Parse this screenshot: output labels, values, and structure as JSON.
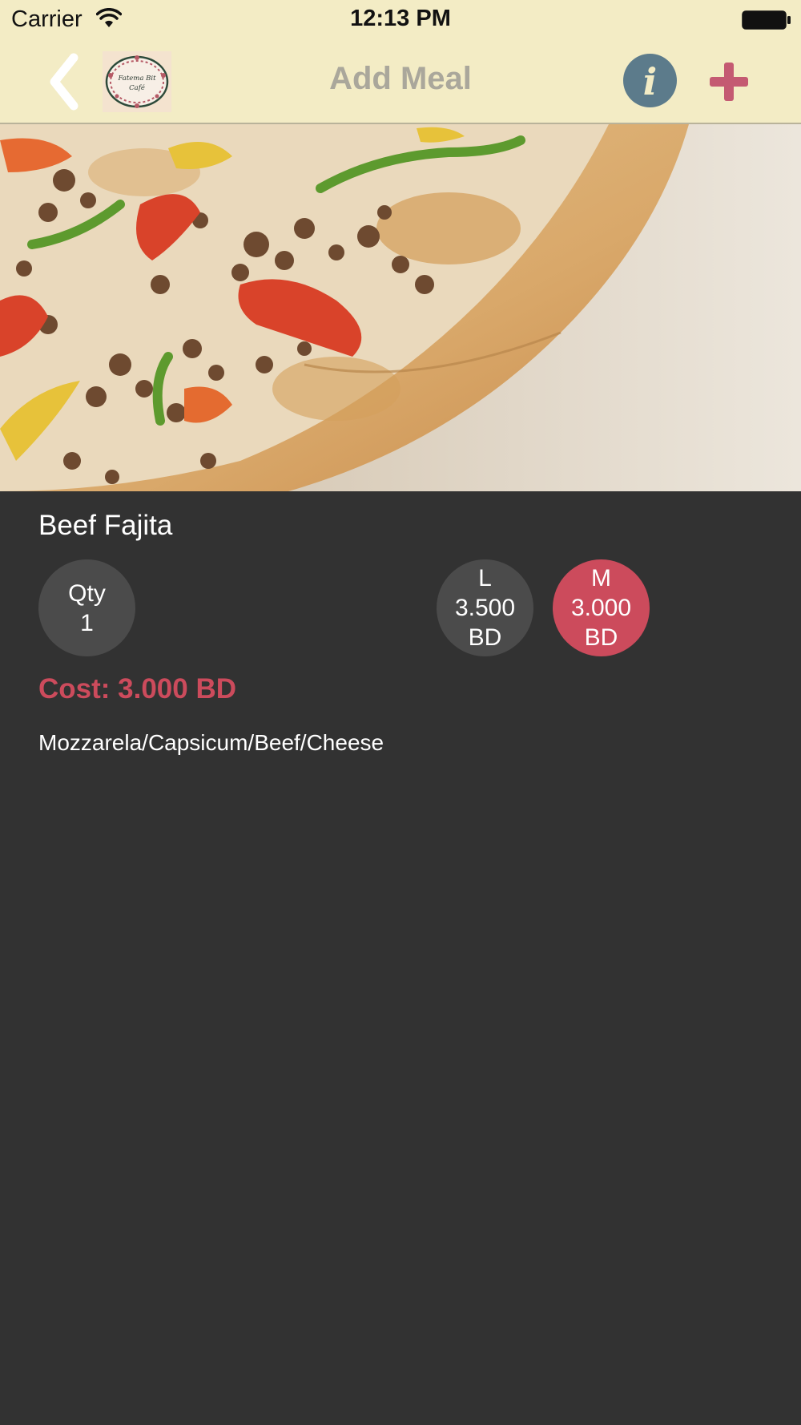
{
  "status_bar": {
    "carrier": "Carrier",
    "time": "12:13 PM"
  },
  "nav": {
    "title": "Add Meal",
    "info_glyph": "i",
    "back_icon": "chevron-left-icon",
    "add_icon": "plus-icon",
    "logo_text_line1": "Fatema Bit",
    "logo_text_line2": "Café"
  },
  "meal": {
    "name": "Beef Fajita",
    "quantity": {
      "label": "Qty",
      "value": "1"
    },
    "sizes": [
      {
        "size": "L",
        "price": "3.500",
        "currency": "BD",
        "selected": false
      },
      {
        "size": "M",
        "price": "3.000",
        "currency": "BD",
        "selected": true
      }
    ],
    "cost": "Cost: 3.000 BD",
    "ingredients": "Mozzarela/Capsicum/Beef/Cheese"
  },
  "colors": {
    "nav_background": "#f3ecc5",
    "content_background": "#323232",
    "accent": "#cc4b5c",
    "info_button": "#5c7b8b",
    "unselected_circle": "#4b4b4b",
    "title_text": "#aaa79b"
  }
}
